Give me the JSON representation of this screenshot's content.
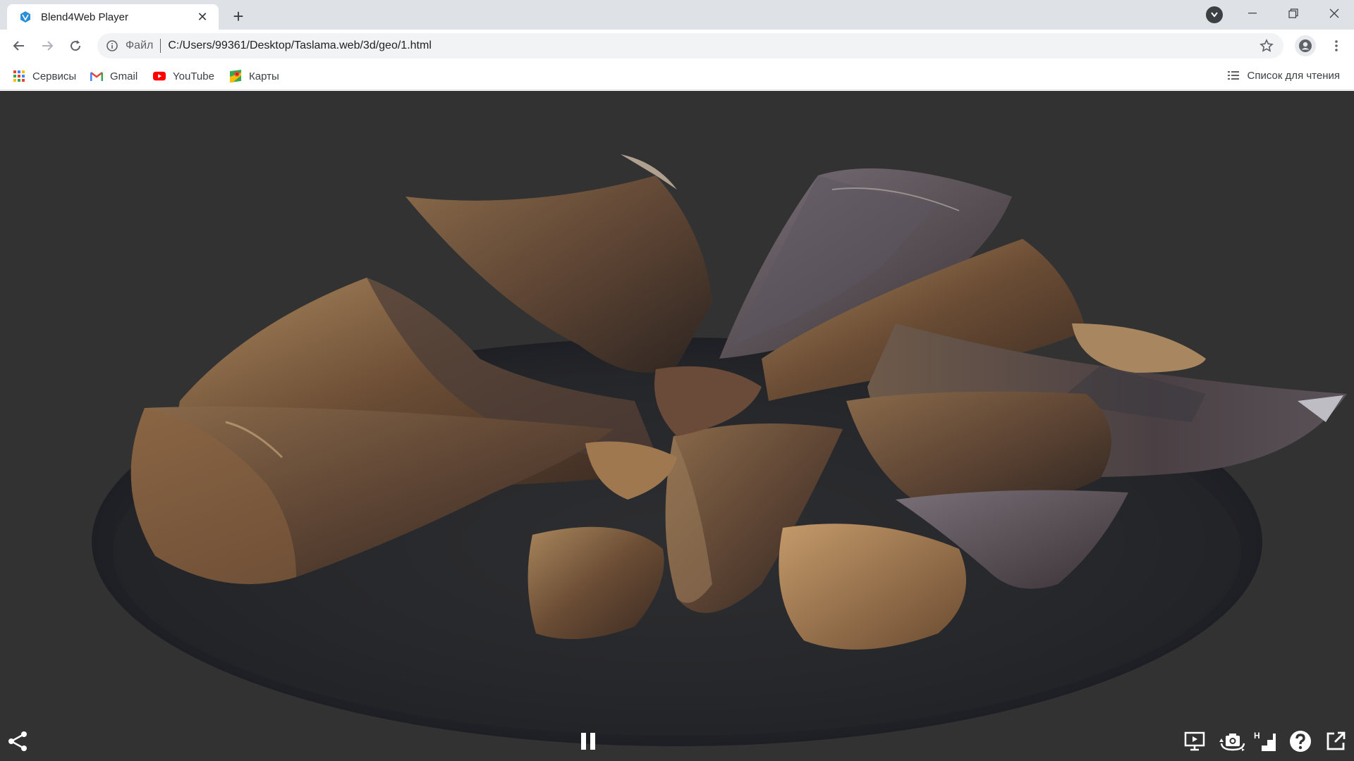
{
  "tab": {
    "title": "Blend4Web Player",
    "close_label": "✕"
  },
  "new_tab_label": "+",
  "window": {
    "minimize": "—",
    "maximize": "❐",
    "close": "✕"
  },
  "omnibox": {
    "scheme": "Файл",
    "url": "C:/Users/99361/Desktop/Taslama.web/3d/geo/1.html"
  },
  "bookmarks": [
    {
      "label": "Сервисы",
      "icon": "apps-grid-icon"
    },
    {
      "label": "Gmail",
      "icon": "gmail-icon"
    },
    {
      "label": "YouTube",
      "icon": "youtube-icon"
    },
    {
      "label": "Карты",
      "icon": "maps-icon"
    }
  ],
  "reading_list": "Список для чтения",
  "player": {
    "buttons": [
      "share-icon",
      "pause-icon",
      "stereo-icon",
      "camera-rotate-icon",
      "quality-icon",
      "help-icon",
      "fullscreen-icon"
    ],
    "quality_label": "H"
  },
  "colors": {
    "viewport_bg": "#323232",
    "tab_bar_bg": "#dee1e6",
    "accent": "#1a73e8"
  }
}
